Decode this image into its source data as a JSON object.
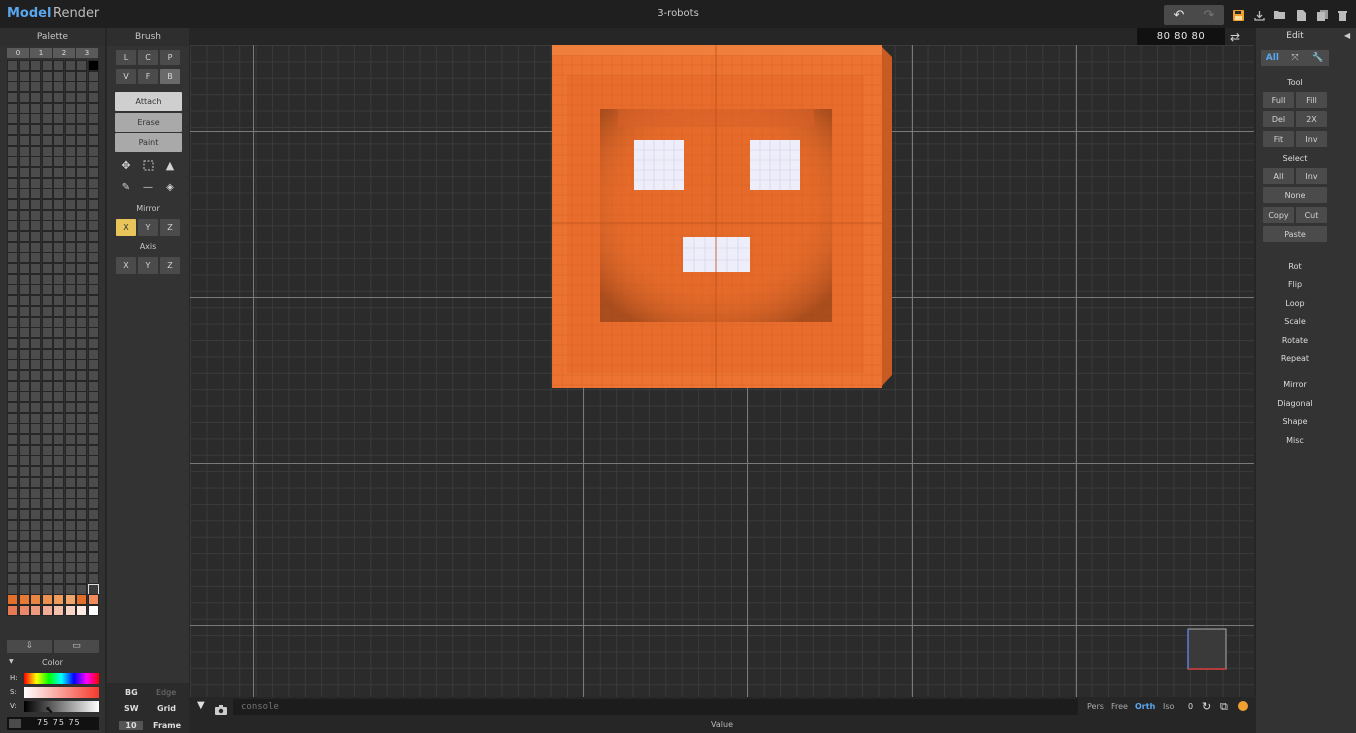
{
  "top": {
    "modes": [
      "Model",
      "Render"
    ],
    "title": "3-robots",
    "undo": "↶",
    "redo": "↷",
    "dims": "80 80 80",
    "icons": [
      "save-icon",
      "export-icon",
      "open-icon",
      "new-icon",
      "duplicate-icon",
      "delete-icon"
    ]
  },
  "palette": {
    "title": "Palette",
    "tabs": [
      "0",
      "1",
      "2",
      "3"
    ],
    "swatch_colors": [
      "#e46f2a",
      "#e87a36",
      "#ea8542",
      "#ec904f",
      "#ee9b5c",
      "#f0a66a",
      "#e46f2a",
      "#ef8b5d",
      "#e77a55",
      "#ea896a",
      "#ee9b80",
      "#f1ad96",
      "#f5c0ac",
      "#f9d5c8",
      "#fdebe4",
      "#ffffff"
    ],
    "action_import": "⇩",
    "action_folder": "▭",
    "color_title": "Color",
    "h_label": "H:",
    "s_label": "S:",
    "v_label": "V:",
    "hsv_values": "75 75 75"
  },
  "brush": {
    "title": "Brush",
    "row1": [
      "L",
      "C",
      "P"
    ],
    "row2": [
      "V",
      "F",
      "B"
    ],
    "modes": [
      "Attach",
      "Erase",
      "Paint"
    ],
    "mirror_title": "Mirror",
    "mirror": [
      "X",
      "Y",
      "Z"
    ],
    "axis_title": "Axis",
    "axis": [
      "X",
      "Y",
      "Z"
    ],
    "bottom": {
      "bg": "BG",
      "edge": "Edge",
      "sw": "SW",
      "grid": "Grid",
      "size": "10",
      "frame": "Frame"
    }
  },
  "viewport": {
    "model_color": "#ec7331",
    "eye_color": "#eeeefb"
  },
  "console": {
    "placeholder": "console",
    "views": [
      "Pers",
      "Free",
      "Orth",
      "Iso"
    ],
    "zero": "0",
    "value_label": "Value"
  },
  "edit": {
    "title": "Edit",
    "tabs": [
      "All",
      "⤧",
      "🔧"
    ],
    "tool_title": "Tool",
    "tool_buttons": [
      [
        "Full",
        "Fill"
      ],
      [
        "Del",
        "2X"
      ],
      [
        "Fit",
        "Inv"
      ]
    ],
    "select_title": "Select",
    "select_row1": [
      "All",
      "Inv"
    ],
    "select_none": "None",
    "select_row3": [
      "Copy",
      "Cut"
    ],
    "select_paste": "Paste",
    "ops1": [
      "Rot",
      "Flip",
      "Loop",
      "Scale",
      "Rotate",
      "Repeat"
    ],
    "ops2": [
      "Mirror",
      "Diagonal",
      "Shape",
      "Misc"
    ]
  }
}
